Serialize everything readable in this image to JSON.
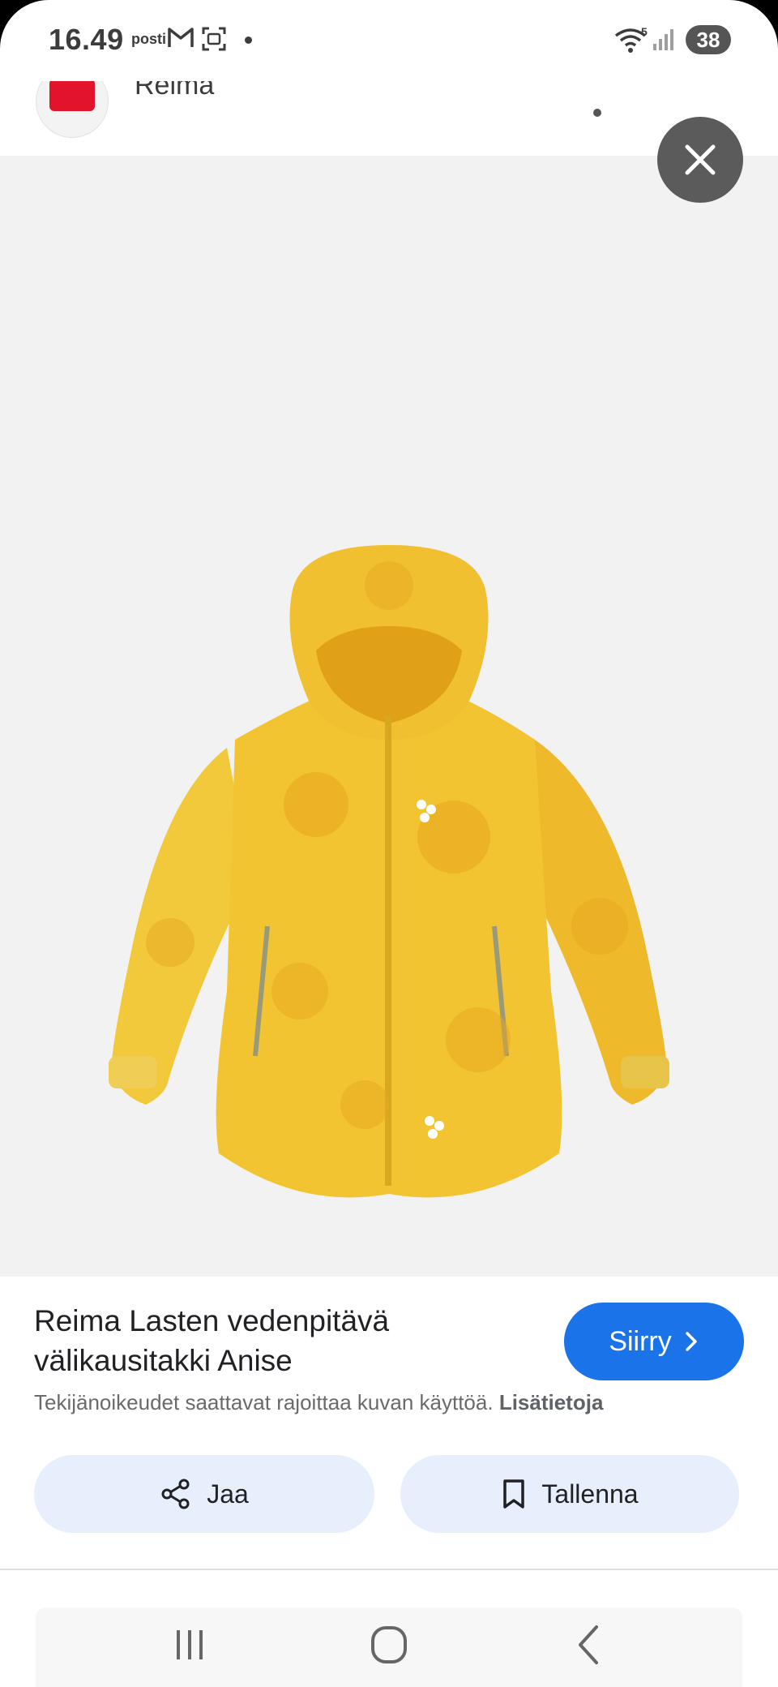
{
  "status_bar": {
    "time": "16.49",
    "carrier": "posti",
    "network": "5",
    "battery": "38"
  },
  "source": {
    "name": "Reima"
  },
  "image": {
    "subject_icon": "jacket-icon"
  },
  "result": {
    "title": "Reima Lasten vedenpitävä välikausitakki Anise",
    "go_label": "Siirry",
    "copyright_text": "Tekijänoikeudet saattavat rajoittaa kuvan käyttöä.",
    "more_info_label": "Lisätietoja",
    "share_label": "Jaa",
    "save_label": "Tallenna"
  },
  "colors": {
    "accent": "#1a73e8",
    "action_bg": "#e7effc",
    "brand_red": "#e1142c",
    "jacket_yellow": "#f3c432"
  }
}
